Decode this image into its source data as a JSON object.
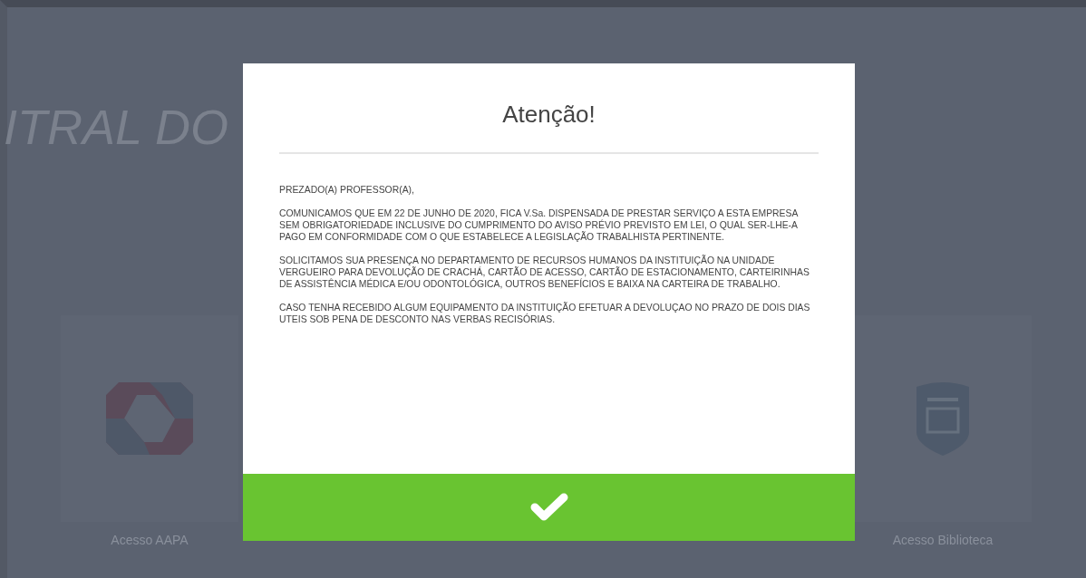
{
  "page": {
    "heading": "ITRAL DO",
    "cards": [
      {
        "kind": "ring",
        "label": "Acesso AAPA"
      },
      {
        "kind": "shield",
        "label": "Acesso Biblioteca"
      }
    ]
  },
  "dialog": {
    "title": "Atenção!",
    "paragraphs": [
      "PREZADO(A) PROFESSOR(A),",
      "COMUNICAMOS QUE EM 22 DE JUNHO DE 2020, FICA V.Sa. DISPENSADA DE PRESTAR SERVIÇO A ESTA EMPRESA SEM OBRIGATORIEDADE INCLUSIVE DO CUMPRIMENTO DO AVISO PRÉVIO PREVISTO EM LEI, O QUAL SER-LHE-A PAGO EM CONFORMIDADE COM O QUE ESTABELECE A LEGISLAÇÃO TRABALHISTA PERTINENTE.",
      "SOLICITAMOS SUA PRESENÇA NO DEPARTAMENTO DE RECURSOS HUMANOS DA INSTITUIÇÃO NA UNIDADE VERGUEIRO PARA DEVOLUÇÃO DE CRACHÁ, CARTÃO DE ACESSO, CARTÃO DE ESTACIONAMENTO, CARTEIRINHAS DE ASSISTÊNCIA MÉDICA E/OU ODONTOLÓGICA, OUTROS BENEFÍCIOS E BAIXA NA CARTEIRA DE TRABALHO.",
      "CASO TENHA RECEBIDO ALGUM EQUIPAMENTO DA INSTITUIÇÃO EFETUAR A DEVOLUÇAO NO PRAZO DE DOIS DIAS UTEIS SOB PENA DE DESCONTO NAS VERBAS RECISÓRIAS."
    ]
  }
}
